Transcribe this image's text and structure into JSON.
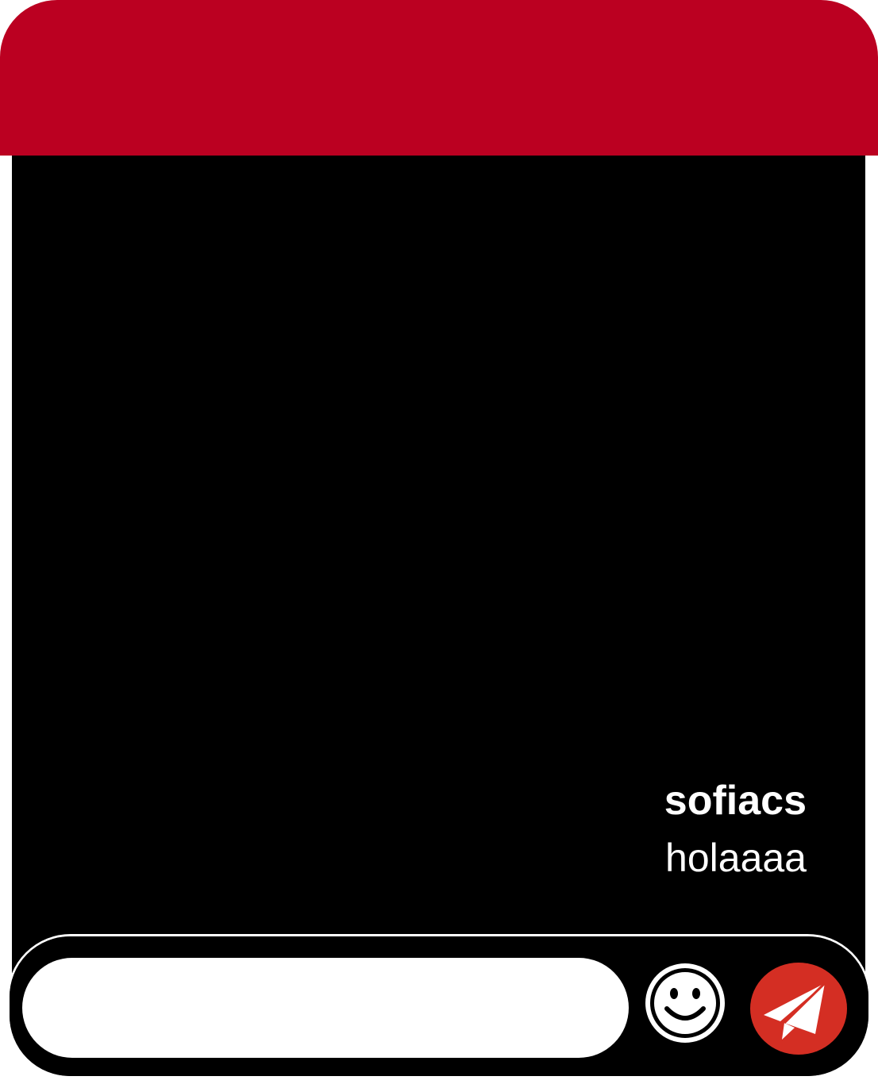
{
  "chat": {
    "messages": [
      {
        "user": "sofiacs",
        "text": "holaaaa"
      }
    ]
  },
  "composer": {
    "input_value": "",
    "input_placeholder": ""
  },
  "icons": {
    "emoji": "smiley-face-icon",
    "send": "paper-plane-icon"
  },
  "colors": {
    "header": "#bb0021",
    "chat_background": "#000000",
    "send_button": "#d42e23",
    "message_text": "#ffffff"
  }
}
